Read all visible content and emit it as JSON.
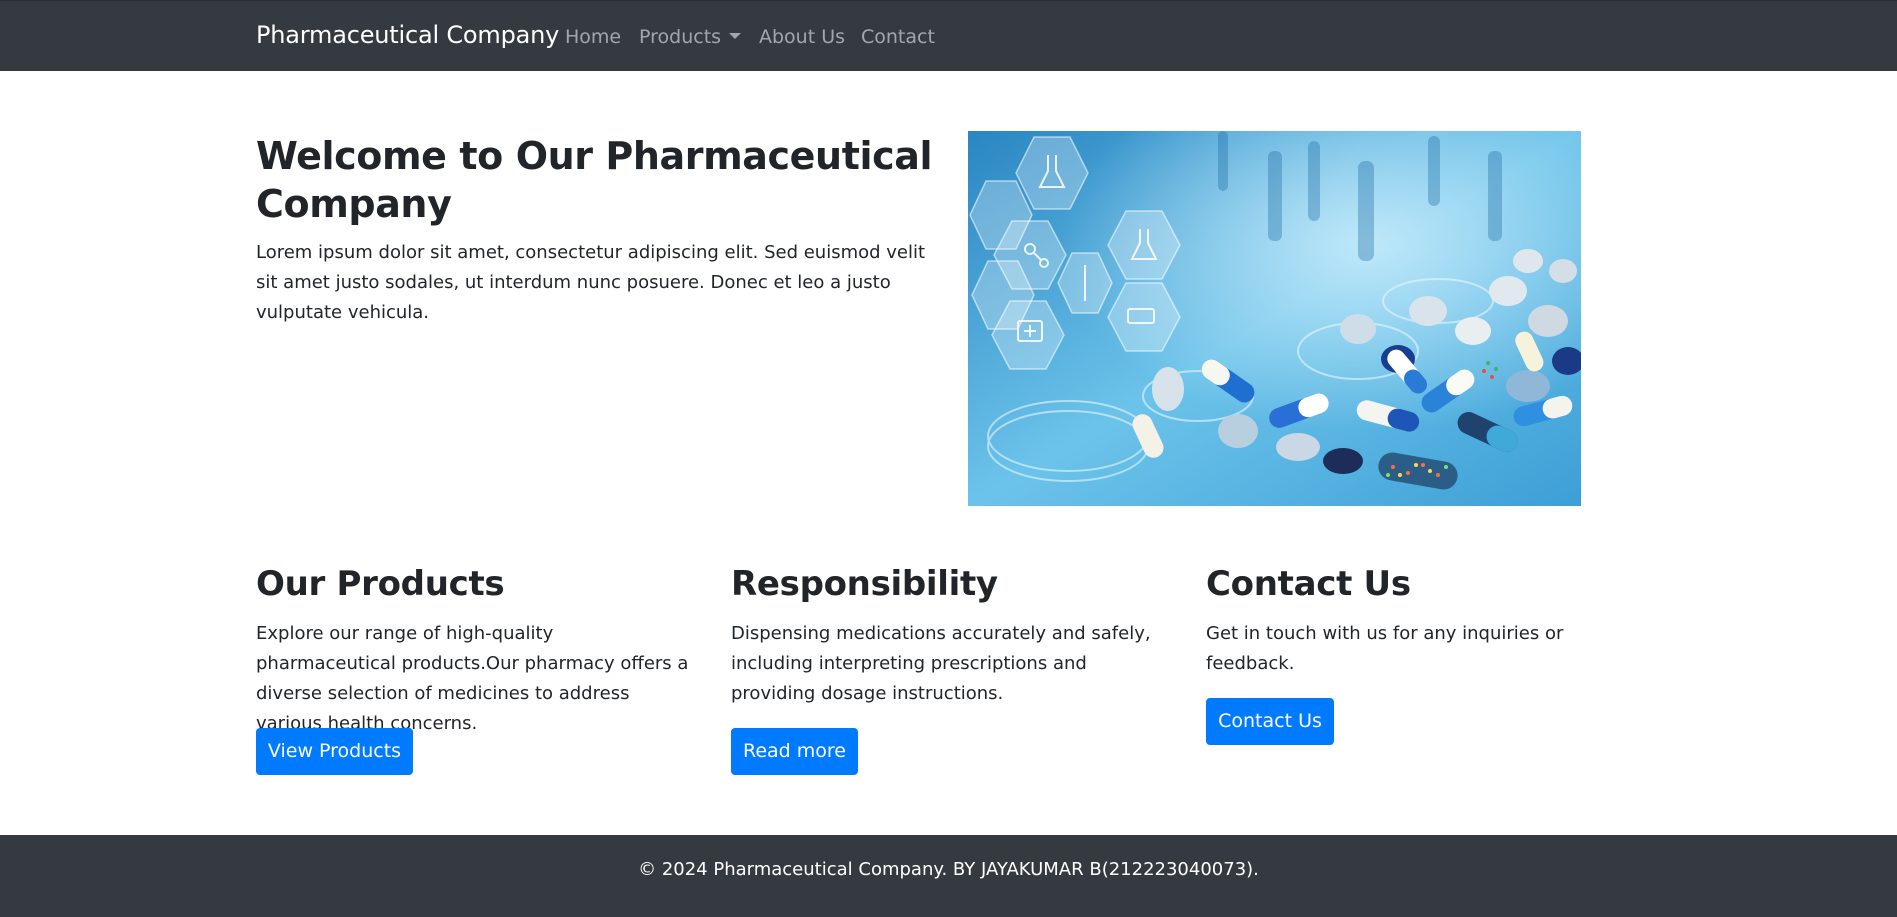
{
  "navbar": {
    "brand": "Pharmaceutical Company",
    "links": [
      {
        "label": "Home"
      },
      {
        "label": "Products"
      },
      {
        "label": "About Us"
      },
      {
        "label": "Contact"
      }
    ]
  },
  "hero": {
    "title": "Welcome to Our Pharmaceutical Company",
    "text": "Lorem ipsum dolor sit amet, consectetur adipiscing elit. Sed euismod velit sit amet justo sodales, ut interdum nunc posuere. Donec et leo a justo vulputate vehicula."
  },
  "columns": [
    {
      "title": "Our Products",
      "text": "Explore our range of high-quality pharmaceutical products.Our pharmacy offers a diverse selection of medicines to address various health concerns.",
      "button": "View Products"
    },
    {
      "title": "Responsibility",
      "text": "Dispensing medications accurately and safely, including interpreting prescriptions and providing dosage instructions.",
      "button": "Read more"
    },
    {
      "title": "Contact Us",
      "text": "Get in touch with us for any inquiries or feedback.",
      "button": "Contact Us"
    }
  ],
  "footer": {
    "text": "© 2024 Pharmaceutical Company. BY JAYAKUMAR B(212223040073)."
  },
  "colors": {
    "navbar_bg": "#343a40",
    "primary_button": "#007bff",
    "footer_bg": "#343a40"
  }
}
